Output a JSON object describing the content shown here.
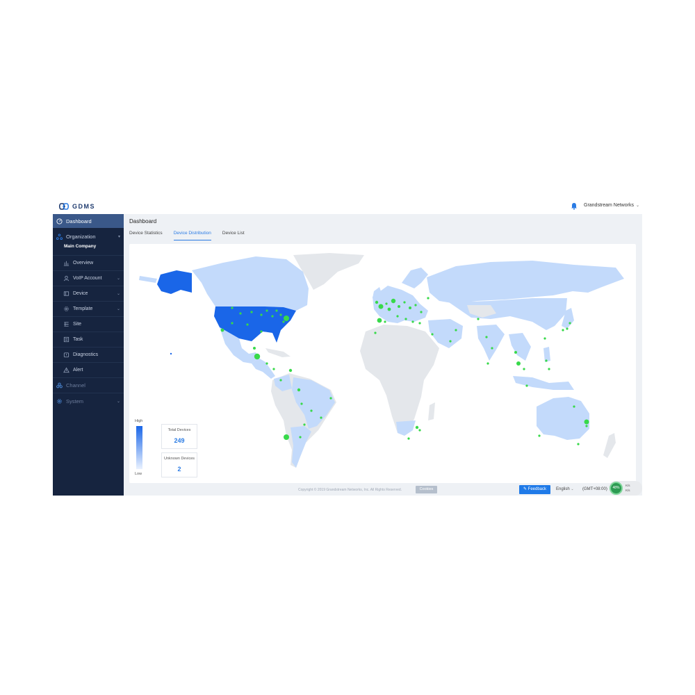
{
  "app": {
    "name": "GDMS"
  },
  "header": {
    "company": "Grandstream Networks"
  },
  "sidebar": {
    "dashboard": "Dashboard",
    "organization": "Organization",
    "main_company": "Main Company",
    "items": [
      "Overview",
      "VoIP Account",
      "Device",
      "Template",
      "Site",
      "Task",
      "Diagnostics",
      "Alert"
    ],
    "channel": "Channel",
    "system": "System"
  },
  "page": {
    "title": "Dashboard",
    "tabs": [
      "Device Statistics",
      "Device Distribution",
      "Device List"
    ],
    "active_tab": "Device Distribution"
  },
  "map": {
    "legend_high": "High",
    "legend_low": "Low",
    "high_color": "#1a66e8",
    "low_color": "#d3e3fb",
    "no_data_color": "#e4e7eb",
    "marker_color": "#38d94a",
    "stats": {
      "total_label": "Total Devices",
      "total_value": "249",
      "unknown_label": "Unknown Devices",
      "unknown_value": "2"
    }
  },
  "footer": {
    "copyright": "Copyright © 2019 Grandstream Networks, Inc. All Rights Reserved.",
    "cookies": "Cookies",
    "feedback": "Feedback",
    "language": "English",
    "timezone": "(GMT+08:00)",
    "net_percent": "48%",
    "up_speed": "K/s",
    "down_speed": "K/s"
  }
}
